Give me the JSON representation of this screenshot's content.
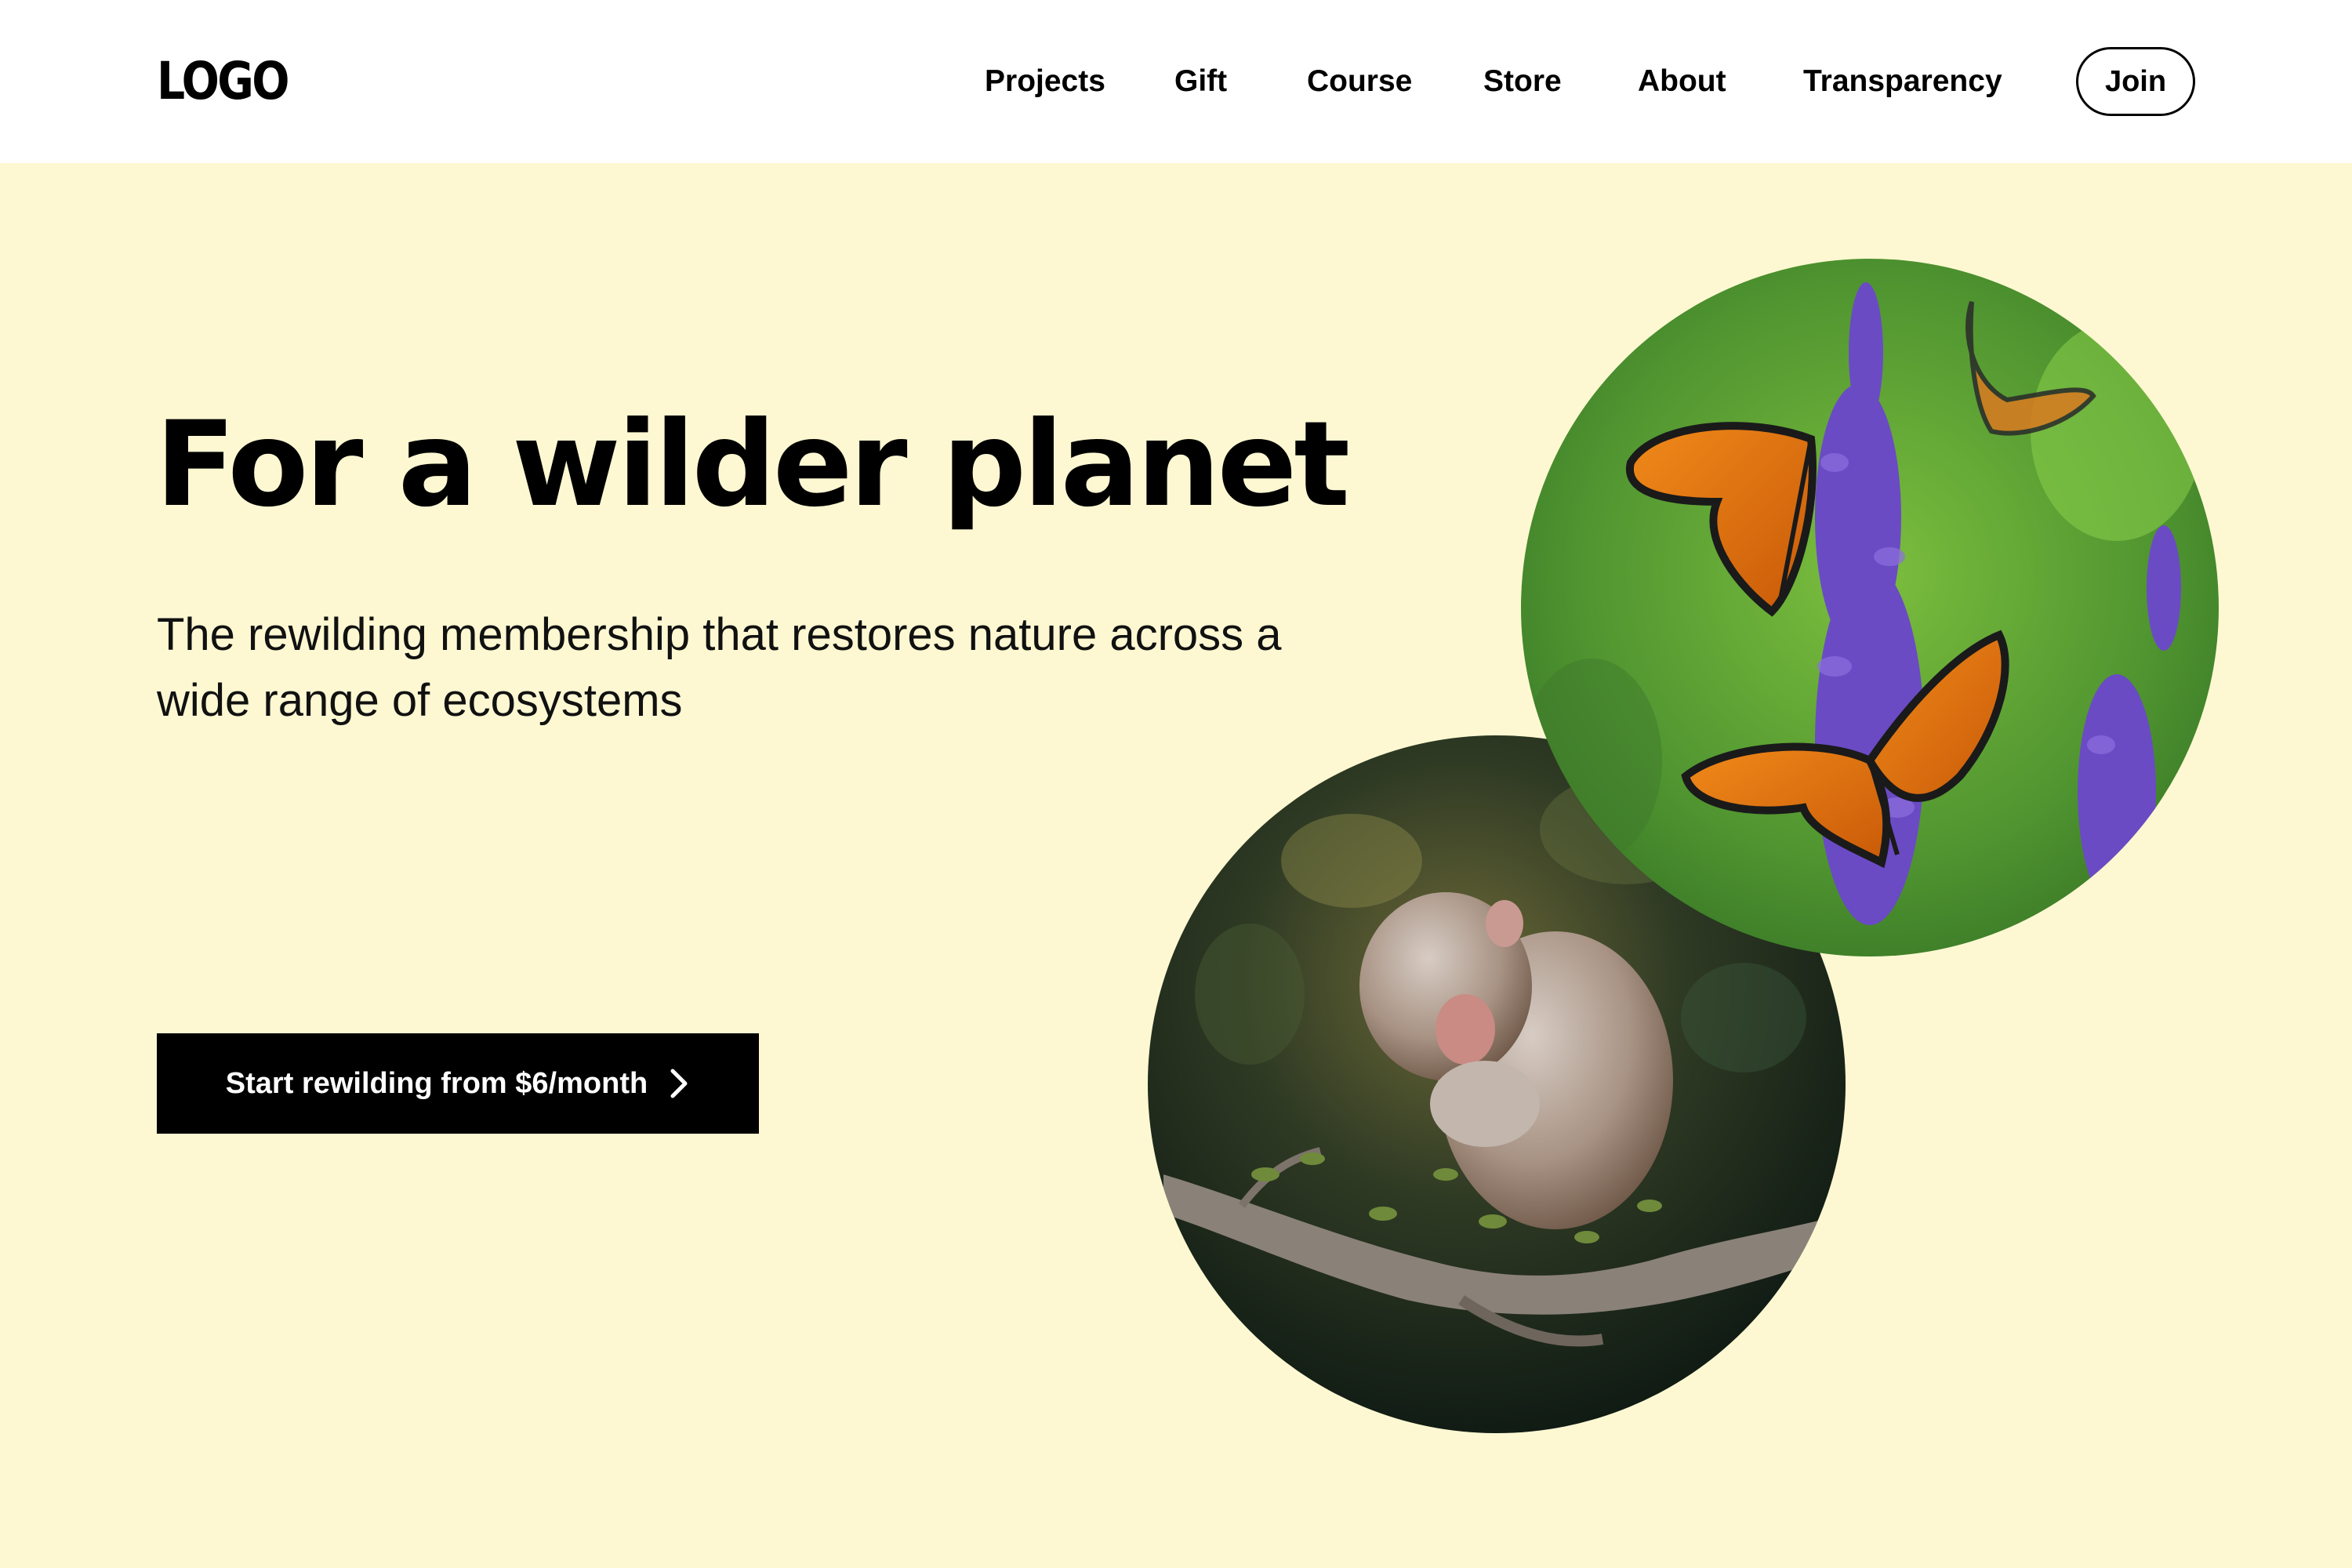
{
  "header": {
    "logo_text": "LOGO",
    "nav": [
      {
        "label": "Projects"
      },
      {
        "label": "Gift"
      },
      {
        "label": "Course"
      },
      {
        "label": "Store"
      },
      {
        "label": "About"
      },
      {
        "label": "Transparency"
      }
    ],
    "join_label": "Join"
  },
  "hero": {
    "title": "For a wilder planet",
    "subtitle": "The rewilding membership that restores nature across a wide range of ecosystems",
    "cta_label": "Start rewilding from $6/month",
    "cta_icon": "chevron-right-icon"
  },
  "images": {
    "butterflies": "monarch butterflies on purple salvia flowers",
    "monkey": "young macaque sitting on a branch"
  },
  "colors": {
    "page_background": "#fdf8d2",
    "header_background": "#ffffff",
    "cta_background": "#000000",
    "cta_text": "#ffffff"
  }
}
